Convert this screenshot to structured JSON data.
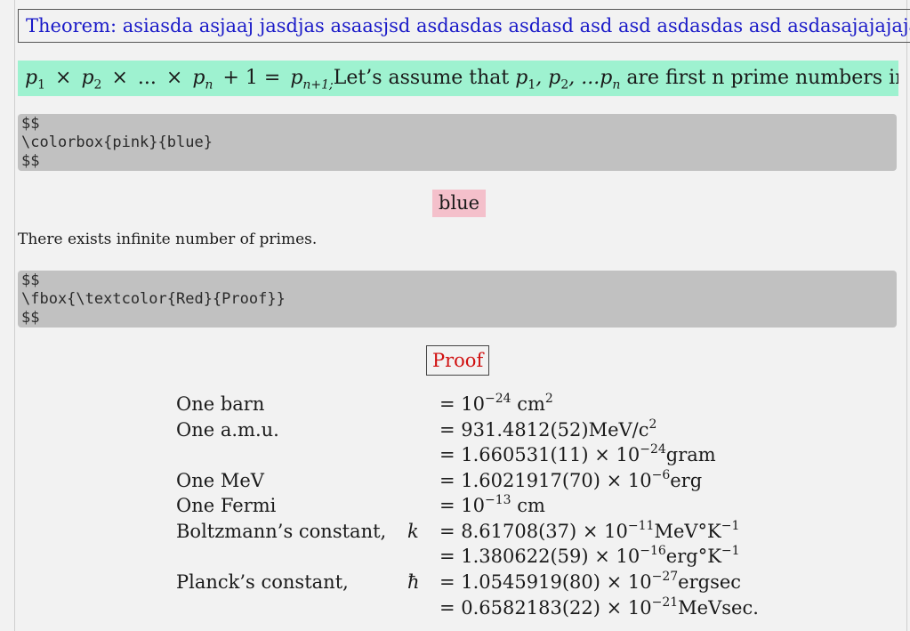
{
  "theorem": {
    "label": "Theorem:",
    "text": "asiasda asjaaj jasdjas asaasjsd asdasdas asdasd asd asd asdasdas asd asdasajajajaja"
  },
  "primes_block": {
    "lhs": [
      "p",
      "1",
      "×",
      "p",
      "2",
      "×",
      "...",
      "×",
      "p",
      "n",
      "+ 1 =",
      "p",
      "n+1;"
    ],
    "sentence_a": "Let’s assume that",
    "seq_a": "p",
    "seq_a_sub": "1",
    "seq_b": ", p",
    "seq_b_sub": "2",
    "seq_c": ", ...p",
    "seq_c_sub": "n",
    "sentence_b": "are first n prime numbers in the sequence"
  },
  "code_blocks": [
    {
      "lines": [
        "$$",
        "\\colorbox{pink}{blue}",
        "$$"
      ]
    },
    {
      "lines": [
        "$$",
        "\\fbox{\\textcolor{Red}{Proof}}",
        "$$"
      ]
    }
  ],
  "colorbox_text": "blue",
  "statement": "There exists infinite number of primes.",
  "proof_text": "Proof",
  "constants": [
    {
      "label": "One barn",
      "symbol": "",
      "value": "= 10",
      "sup": "−24",
      "rest": " cm",
      "sup2": "2",
      "rest2": ""
    },
    {
      "label": "One a.m.u.",
      "symbol": "",
      "value": "= 931.4812(52)MeV/c",
      "sup": "2",
      "rest": "",
      "sup2": "",
      "rest2": ""
    },
    {
      "label": "",
      "symbol": "",
      "value": "= 1.660531(11) × 10",
      "sup": "−24",
      "rest": "gram",
      "sup2": "",
      "rest2": ""
    },
    {
      "label": "One MeV",
      "symbol": "",
      "value": "= 1.6021917(70) × 10",
      "sup": "−6",
      "rest": "erg",
      "sup2": "",
      "rest2": ""
    },
    {
      "label": "One Fermi",
      "symbol": "",
      "value": "= 10",
      "sup": "−13",
      "rest": " cm",
      "sup2": "",
      "rest2": ""
    },
    {
      "label": "Boltzmann’s constant,",
      "symbol": "k",
      "value": "= 8.61708(37) × 10",
      "sup": "−11",
      "rest": "MeV°K",
      "sup2": "−1",
      "rest2": ""
    },
    {
      "label": "",
      "symbol": "",
      "value": "= 1.380622(59) × 10",
      "sup": "−16",
      "rest": "erg°K",
      "sup2": "−1",
      "rest2": ""
    },
    {
      "label": "Planck’s constant,",
      "symbol": "ħ",
      "value": "= 1.0545919(80) × 10",
      "sup": "−27",
      "rest": "ergsec",
      "sup2": "",
      "rest2": ""
    },
    {
      "label": "",
      "symbol": "",
      "value": "= 0.6582183(22) × 10",
      "sup": "−21",
      "rest": "MeVsec.",
      "sup2": "",
      "rest2": ""
    }
  ]
}
